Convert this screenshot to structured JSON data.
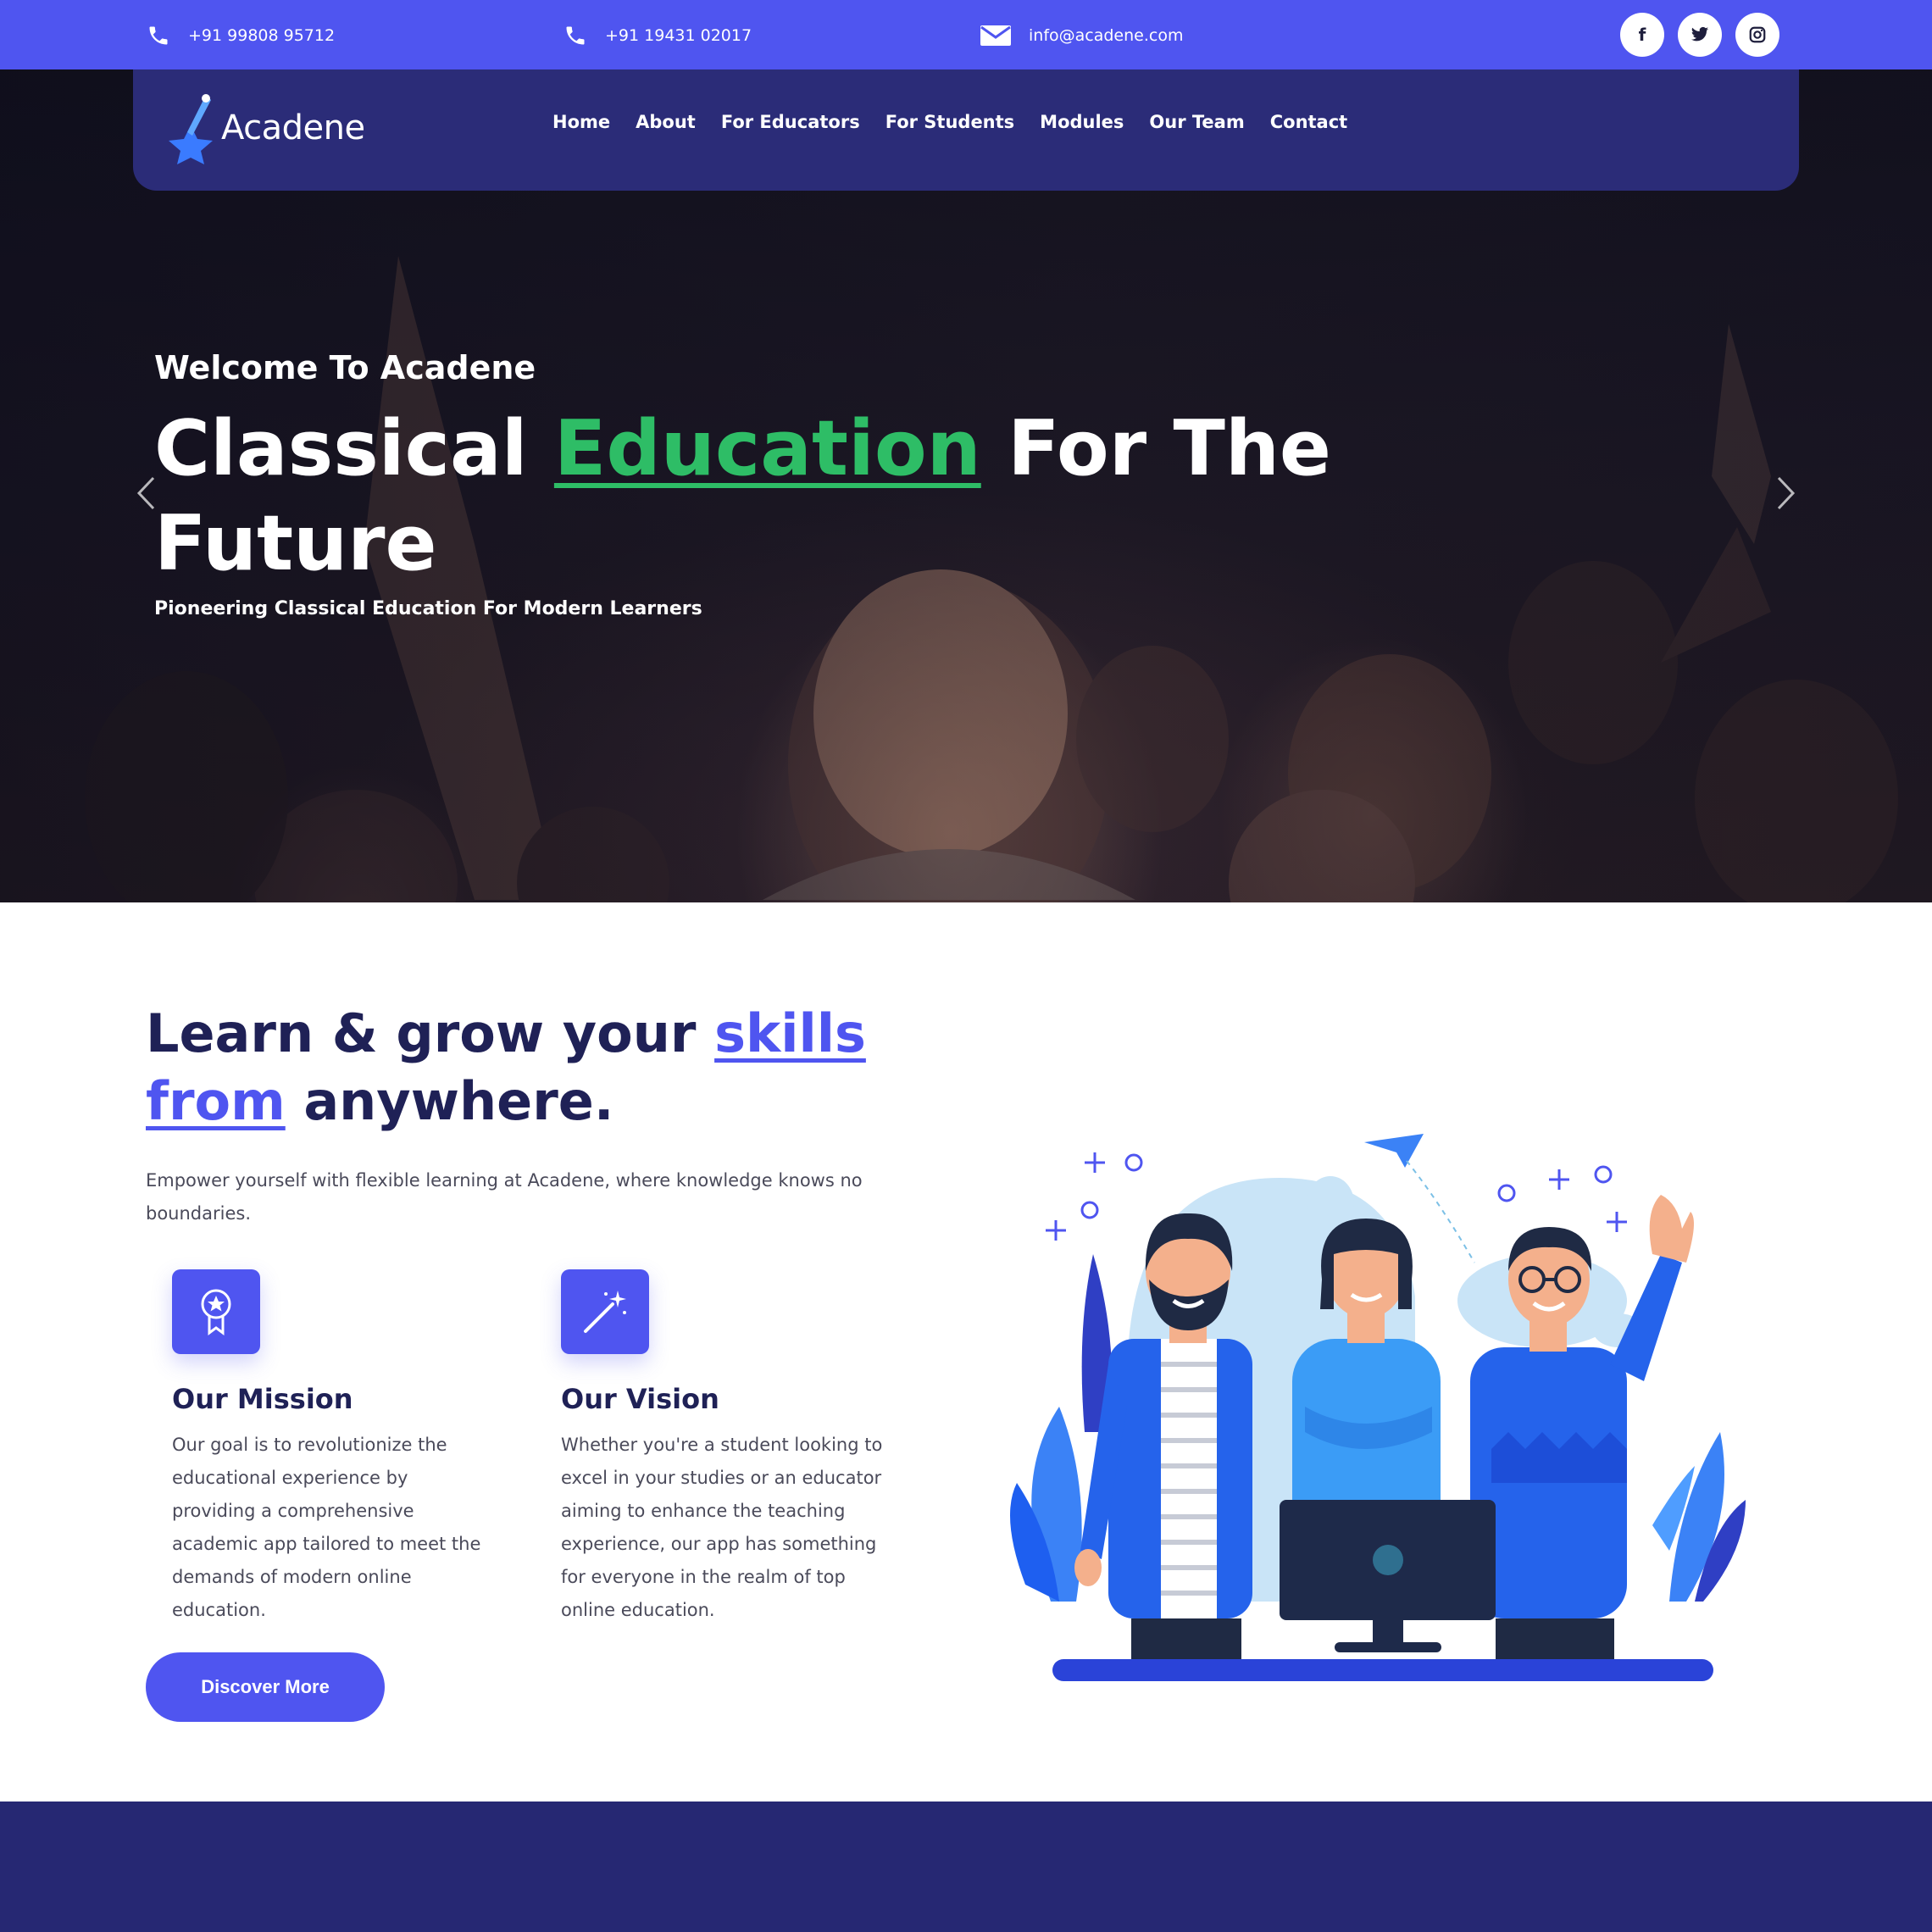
{
  "topbar": {
    "phone1": "+91 99808 95712",
    "phone2": "+91 19431 02017",
    "email": "info@acadene.com",
    "socials": [
      {
        "icon": "facebook-icon",
        "glyph": "f"
      },
      {
        "icon": "twitter-icon",
        "glyph": "t"
      },
      {
        "icon": "instagram-icon",
        "glyph": "◎"
      }
    ]
  },
  "brand": {
    "name": "Acadene"
  },
  "nav": {
    "items": [
      "Home",
      "About",
      "For Educators",
      "For Students",
      "Modules",
      "Our Team",
      "Contact"
    ]
  },
  "hero": {
    "welcome": "Welcome To Acadene",
    "headline_pre": "Classical ",
    "headline_highlight": "Education",
    "headline_post": " For The Future",
    "subline": "Pioneering Classical Education For Modern Learners"
  },
  "about": {
    "title_pre": "Learn & grow your ",
    "title_highlight": "skills from",
    "title_post": " anywhere.",
    "description": "Empower yourself with flexible learning at Acadene, where knowledge knows no boundaries.",
    "mission": {
      "icon": "award-ribbon-icon",
      "title": "Our Mission",
      "text": "Our goal is to revolutionize the educational experience by providing a comprehensive academic app tailored to meet the demands of modern online education."
    },
    "vision": {
      "icon": "magic-wand-icon",
      "title": "Our Vision",
      "text": "Whether you're a student looking to excel in your studies or an educator aiming to enhance the teaching experience, our app has something for everyone in the realm of top online education."
    },
    "cta_label": "Discover More"
  },
  "colors": {
    "primary": "#4f55f0",
    "navy": "#2b2c78",
    "heading": "#1f2156",
    "accent_green": "#2ebd66",
    "footer_band": "#262873"
  }
}
